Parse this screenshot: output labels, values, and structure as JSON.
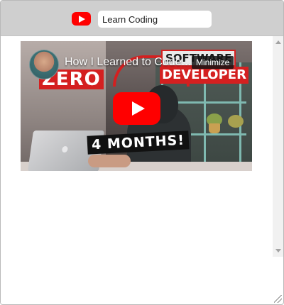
{
  "header": {
    "logo_icon": "youtube-logo-icon",
    "search": {
      "value": "Learn Coding",
      "placeholder": ""
    }
  },
  "video": {
    "title": "How I Learned to Code...",
    "tooltip": "Minimize",
    "thumbnail_text": {
      "zero": "ZERO",
      "software": "SOFTWARE",
      "developer": "DEVELOPER",
      "months": "4 MONTHS!"
    },
    "play_icon": "play-icon",
    "accent_color": "#ff0000"
  },
  "scrollbar": {
    "up_icon": "scroll-up-arrow-icon",
    "down_icon": "scroll-down-arrow-icon"
  }
}
